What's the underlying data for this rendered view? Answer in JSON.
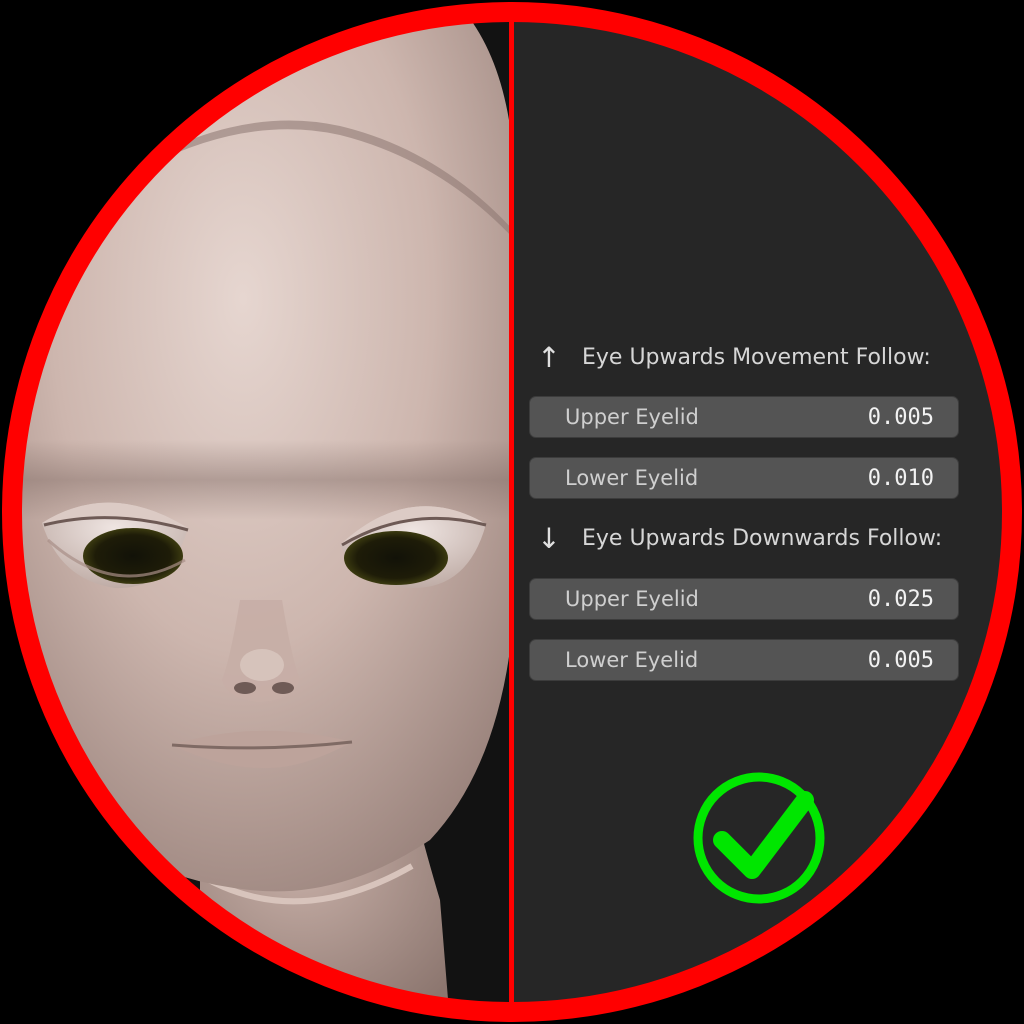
{
  "eye_panel": {
    "upwards_header": {
      "icon": "arrow-up-icon",
      "glyph": "↑",
      "title": "Eye Upwards Movement Follow:"
    },
    "upwards_fields": [
      {
        "label": "Upper Eyelid",
        "value": "0.005"
      },
      {
        "label": "Lower Eyelid",
        "value": "0.010"
      }
    ],
    "downwards_header": {
      "icon": "arrow-down-icon",
      "glyph": "↓",
      "title": "Eye Upwards Downwards Follow:"
    },
    "downwards_fields": [
      {
        "label": "Upper Eyelid",
        "value": "0.025"
      },
      {
        "label": "Lower Eyelid",
        "value": "0.005"
      }
    ]
  },
  "badge": {
    "icon": "checkmark-icon",
    "color": "#00e600"
  },
  "frame": {
    "ring_color": "#ff0000",
    "panel_bg": "#262626"
  }
}
